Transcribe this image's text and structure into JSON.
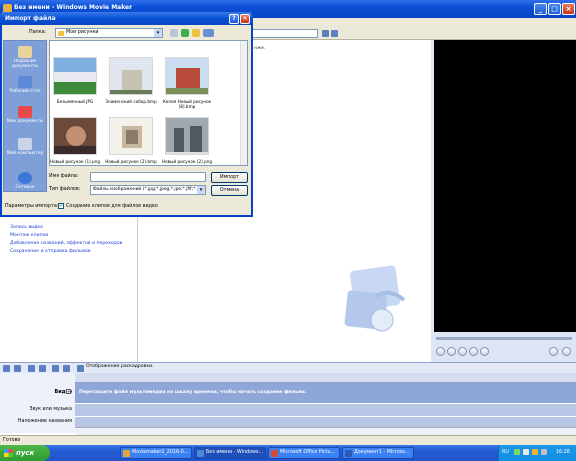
{
  "app": {
    "title": "Без имени - Windows Movie Maker",
    "collection_hint": "нже.",
    "tasks": [
      "Запись видео",
      "Монтаж клипов",
      "Добавление названий, эффектов и переходов",
      "Сохранение и отправка фильмов"
    ],
    "timeline": {
      "show_storyboard": "Отображение раскадровки.",
      "tracks": {
        "video": "Видео",
        "audio": "Звук или музыка",
        "titles": "Наложение названия"
      },
      "video_hint": "Перетащите файл мультимедиа на шкалу времени, чтобы начать создание фильма."
    },
    "status": "Готово"
  },
  "dialog": {
    "title": "Импорт файла",
    "help": "?",
    "close": "✕",
    "folder_label": "Папка:",
    "folder_value": "Мои рисунки",
    "places": [
      "Недавние документы",
      "Рабочий стол",
      "Мои документы",
      "Мой компьютер",
      "Сетевое"
    ],
    "files": [
      {
        "name": "Безымянный.JPG",
        "colors": [
          "#7fb0e0",
          "#e8e8f0",
          "#3d8a3a"
        ]
      },
      {
        "name": "Знаменский собор.bmp",
        "colors": [
          "#dfe6f0",
          "#c8c2b4",
          "#6a7d5a"
        ]
      },
      {
        "name": "Копия Новый рисунок (8).bmp",
        "colors": [
          "#c9dcf0",
          "#b84a3a",
          "#7a8f5a"
        ]
      },
      {
        "name": "Новый рисунок (1).png",
        "colors": [
          "#6b4a3a",
          "#c09070",
          "#3a2a2a"
        ]
      },
      {
        "name": "Новый рисунок (2).bmp",
        "colors": [
          "#f4f0ea",
          "#c8b8a0",
          "#8a7a68"
        ]
      },
      {
        "name": "Новый рисунок (2).png",
        "colors": [
          "#a0a8b0",
          "#505860",
          "#e0e0e0"
        ]
      }
    ],
    "filename_label": "Имя файла:",
    "filename_value": "",
    "filetype_label": "Тип файлов:",
    "filetype_value": "Файлы изображений (*.jpg;*.jpeg;*.jpe;*.jfif;*.",
    "import_button": "Импорт",
    "cancel_button": "Отмена",
    "params_label": "Параметры импорта:",
    "create_clips_label": "Создание клипов для файлов видео",
    "create_clips_checked": true
  },
  "taskbar": {
    "start": "пуск",
    "items": [
      {
        "label": "Moviemaker2_2016-0...",
        "color": "#e6a23c"
      },
      {
        "label": "Без имени - Windows...",
        "color": "#4a8ad8"
      },
      {
        "label": "Microsoft Office Pictu...",
        "color": "#d04a3a"
      },
      {
        "label": "Документ1 - Microso...",
        "color": "#2a5ab8"
      }
    ],
    "lang": "RU",
    "clock": "16:28"
  }
}
